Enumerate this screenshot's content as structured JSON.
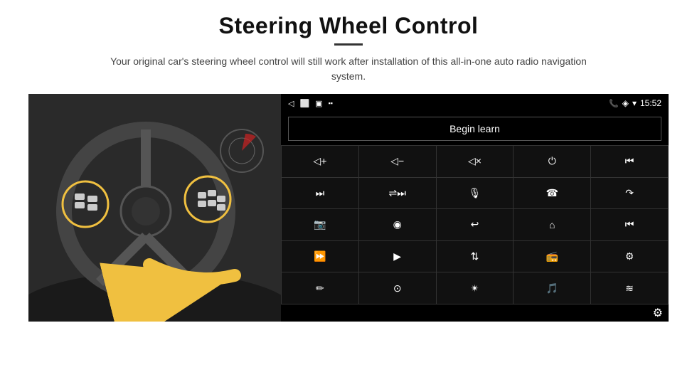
{
  "page": {
    "title": "Steering Wheel Control",
    "subtitle": "Your original car's steering wheel control will still work after installation of this all-in-one auto radio navigation system.",
    "divider": true
  },
  "status_bar": {
    "back_icon": "◁",
    "home_icon": "⬜",
    "recents_icon": "▣",
    "signal_icon": "▪▪",
    "phone_icon": "📞",
    "location_icon": "◈",
    "wifi_icon": "▾",
    "time": "15:52"
  },
  "begin_learn": {
    "label": "Begin learn"
  },
  "controls": [
    {
      "icon": "vol-up",
      "symbol": "◁+",
      "label": "volume up"
    },
    {
      "icon": "vol-down",
      "symbol": "◁−",
      "label": "volume down"
    },
    {
      "icon": "mute",
      "symbol": "◁×",
      "label": "mute"
    },
    {
      "icon": "power",
      "symbol": "⏻",
      "label": "power"
    },
    {
      "icon": "prev-skip",
      "symbol": "⏮",
      "label": "previous/skip"
    },
    {
      "icon": "next-track",
      "symbol": "⏭",
      "label": "next track"
    },
    {
      "icon": "shuffle",
      "symbol": "⇌⏭",
      "label": "shuffle next"
    },
    {
      "icon": "mic",
      "symbol": "🎙",
      "label": "microphone"
    },
    {
      "icon": "phone-call",
      "symbol": "☎",
      "label": "phone call"
    },
    {
      "icon": "end-call",
      "symbol": "↷",
      "label": "end call"
    },
    {
      "icon": "camera",
      "symbol": "📷",
      "label": "camera"
    },
    {
      "icon": "360-view",
      "symbol": "◉360",
      "label": "360 view"
    },
    {
      "icon": "back-arrow",
      "symbol": "↩",
      "label": "back"
    },
    {
      "icon": "home-btn",
      "symbol": "⌂",
      "label": "home"
    },
    {
      "icon": "skip-back",
      "symbol": "⏮",
      "label": "skip back"
    },
    {
      "icon": "fast-forward",
      "symbol": "⏩",
      "label": "fast forward"
    },
    {
      "icon": "navigate",
      "symbol": "▶",
      "label": "navigate"
    },
    {
      "icon": "equalizer",
      "symbol": "⇅",
      "label": "equalizer"
    },
    {
      "icon": "radio-record",
      "symbol": "📻",
      "label": "radio record"
    },
    {
      "icon": "tune-adjust",
      "symbol": "⚙",
      "label": "tune adjust"
    },
    {
      "icon": "pen-edit",
      "symbol": "✏",
      "label": "pen edit"
    },
    {
      "icon": "disc",
      "symbol": "⊙",
      "label": "disc"
    },
    {
      "icon": "bluetooth",
      "symbol": "*",
      "label": "bluetooth"
    },
    {
      "icon": "music-settings",
      "symbol": "🎵",
      "label": "music settings"
    },
    {
      "icon": "sound-wave",
      "symbol": "≋",
      "label": "sound wave"
    }
  ],
  "settings_icon": "⚙"
}
